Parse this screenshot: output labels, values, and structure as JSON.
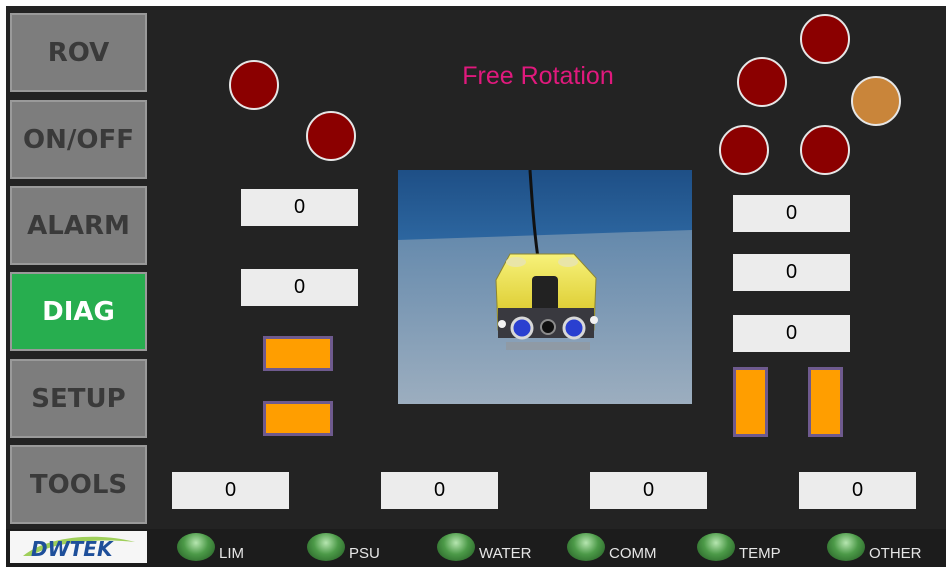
{
  "nav": {
    "rov": "ROV",
    "onoff": "ON/OFF",
    "alarm": "ALARM",
    "diag": "DIAG",
    "setup": "SETUP",
    "tools": "TOOLS"
  },
  "title": "Free Rotation",
  "values": {
    "left_1": "0",
    "left_2": "0",
    "right_1": "0",
    "right_2": "0",
    "right_3": "0",
    "bottom_1": "0",
    "bottom_2": "0",
    "bottom_3": "0",
    "bottom_4": "0"
  },
  "status": {
    "lim": "LIM",
    "psu": "PSU",
    "water": "WATER",
    "comm": "COMM",
    "temp": "TEMP",
    "other": "OTHER"
  },
  "logo": "DWTEK",
  "colors": {
    "background": "#232323",
    "nav_button": "#7d7d7d",
    "nav_active": "#27ae4f",
    "alarm_lamp": "#8b0000",
    "warning_lamp": "#c9853a",
    "indicator_bar": "#ff9e00",
    "title_text": "#e0197d",
    "status_led": "#4c9a48"
  }
}
